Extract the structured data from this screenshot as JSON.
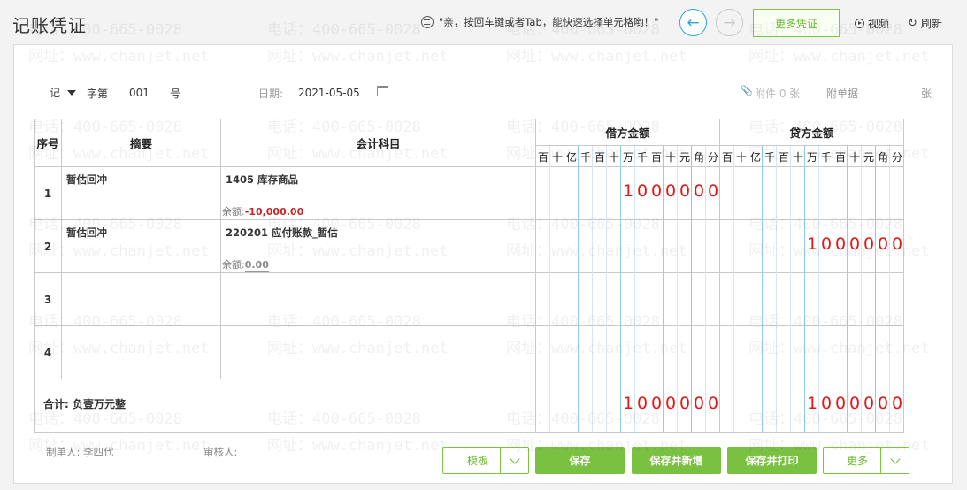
{
  "header": {
    "title": "记账凭证",
    "tip": "\"亲，按回车键或者Tab，能快速选择单元格哟！\"",
    "more_vouchers": "更多凭证",
    "video": "视频",
    "refresh": "刷新"
  },
  "watermark": {
    "phone": "电话：400-665-0028",
    "site": "网址：www.chanjet.net"
  },
  "form": {
    "voucher_word": "记",
    "word_label": "字第",
    "voucher_number": "001",
    "number_suffix": "号",
    "date_label": "日期:",
    "date_value": "2021-05-05",
    "attachment_label": "附件 0 张",
    "attached_docs_label": "附单据",
    "attached_docs_value": "",
    "attached_docs_unit": "张"
  },
  "table": {
    "headers": {
      "seq": "序号",
      "summary": "摘要",
      "account": "会计科目",
      "debit": "借方金额",
      "credit": "贷方金额"
    },
    "digit_headers": [
      "百",
      "十",
      "亿",
      "千",
      "百",
      "十",
      "万",
      "千",
      "百",
      "十",
      "元",
      "角",
      "分"
    ],
    "rows": [
      {
        "no": "1",
        "summary": "暂估回冲",
        "account": "1405 库存商品",
        "balance_label": "余额:",
        "balance_value": "-10,000.00",
        "debit": "1000000",
        "credit": ""
      },
      {
        "no": "2",
        "summary": "暂估回冲",
        "account": "220201 应付账款_暂估",
        "balance_label": "余额:",
        "balance_value": "0.00",
        "debit": "",
        "credit": "1000000"
      },
      {
        "no": "3",
        "summary": "",
        "account": "",
        "debit": "",
        "credit": ""
      },
      {
        "no": "4",
        "summary": "",
        "account": "",
        "debit": "",
        "credit": ""
      }
    ],
    "total_label": "合计:  负壹万元整",
    "total_debit": "1000000",
    "total_credit": "1000000"
  },
  "footer": {
    "maker_label": "制单人:",
    "maker": "李四代",
    "reviewer_label": "审核人:",
    "reviewer": "",
    "template_btn": "模板",
    "save_btn": "保存",
    "save_new_btn": "保存并新增",
    "save_print_btn": "保存并打印",
    "more_btn": "更多"
  },
  "colors": {
    "accent_green": "#7ac142",
    "amount_red": "#e01818",
    "nav_blue": "#2aa7d4"
  }
}
